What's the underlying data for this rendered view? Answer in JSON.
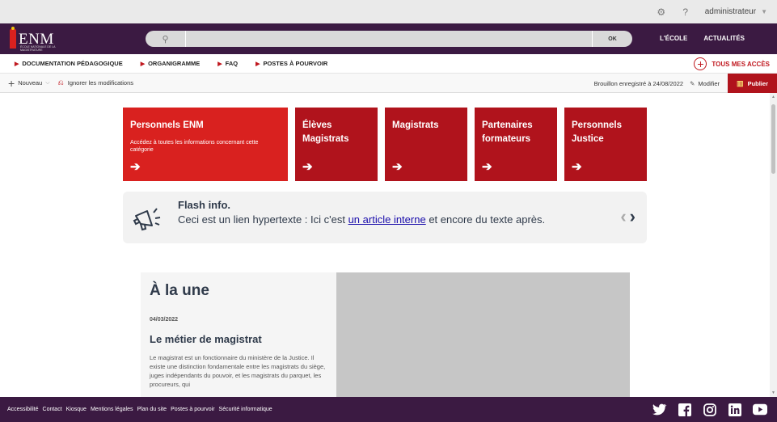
{
  "topbar": {
    "settings_icon": "gear-icon",
    "help_label": "?",
    "user": "administrateur"
  },
  "header": {
    "logo_text": "ENM",
    "logo_sub": "ÉCOLE NATIONALE DE LA MAGISTRATURE",
    "search_value": "",
    "search_button": "OK",
    "nav": [
      "L'ÉCOLE",
      "ACTUALITÉS"
    ]
  },
  "navbar": {
    "items": [
      "DOCUMENTATION PÉDAGOGIQUE",
      "ORGANIGRAMME",
      "FAQ",
      "POSTES À POURVOIR"
    ],
    "all_access": "TOUS MES ACCÈS"
  },
  "edit_toolbar": {
    "new_label": "Nouveau",
    "ignore_label": "Ignorer les modifications",
    "draft_status": "Brouillon enregistré à 24/08/2022",
    "edit_label": "Modifier",
    "publish_label": "Publier"
  },
  "tiles": [
    {
      "title": "Personnels ENM",
      "desc": "Accédez à toutes les informations concernant cette catégorie"
    },
    {
      "title": "Élèves Magistrats"
    },
    {
      "title": "Magistrats"
    },
    {
      "title": "Partenaires formateurs"
    },
    {
      "title": "Personnels Justice"
    }
  ],
  "flash": {
    "title": "Flash info.",
    "text_before": "Ceci est un lien hypertexte : Ici c'est ",
    "link_text": "un article interne",
    "text_after": " et encore du texte après."
  },
  "une": {
    "heading": "À la une",
    "date": "04/03/2022",
    "article_title": "Le métier de magistrat",
    "excerpt": "Le magistrat est un fonctionnaire du ministère de la Justice. Il existe une distinction fondamentale entre les magistrats du siège, juges indépendants du pouvoir, et les magistrats du parquet, les procureurs, qui"
  },
  "footer": {
    "links": [
      "Accessibilité",
      "Contact",
      "Kiosque",
      "Mentions légales",
      "Plan du site",
      "Postes à pourvoir",
      "Sécurité informatique"
    ],
    "social": [
      "twitter-icon",
      "facebook-icon",
      "instagram-icon",
      "linkedin-icon",
      "youtube-icon"
    ]
  },
  "colors": {
    "header_bg": "#3b1a42",
    "tile_red": "#b0131c",
    "tile_highlight": "#d9211f",
    "accent": "#c0181f"
  }
}
